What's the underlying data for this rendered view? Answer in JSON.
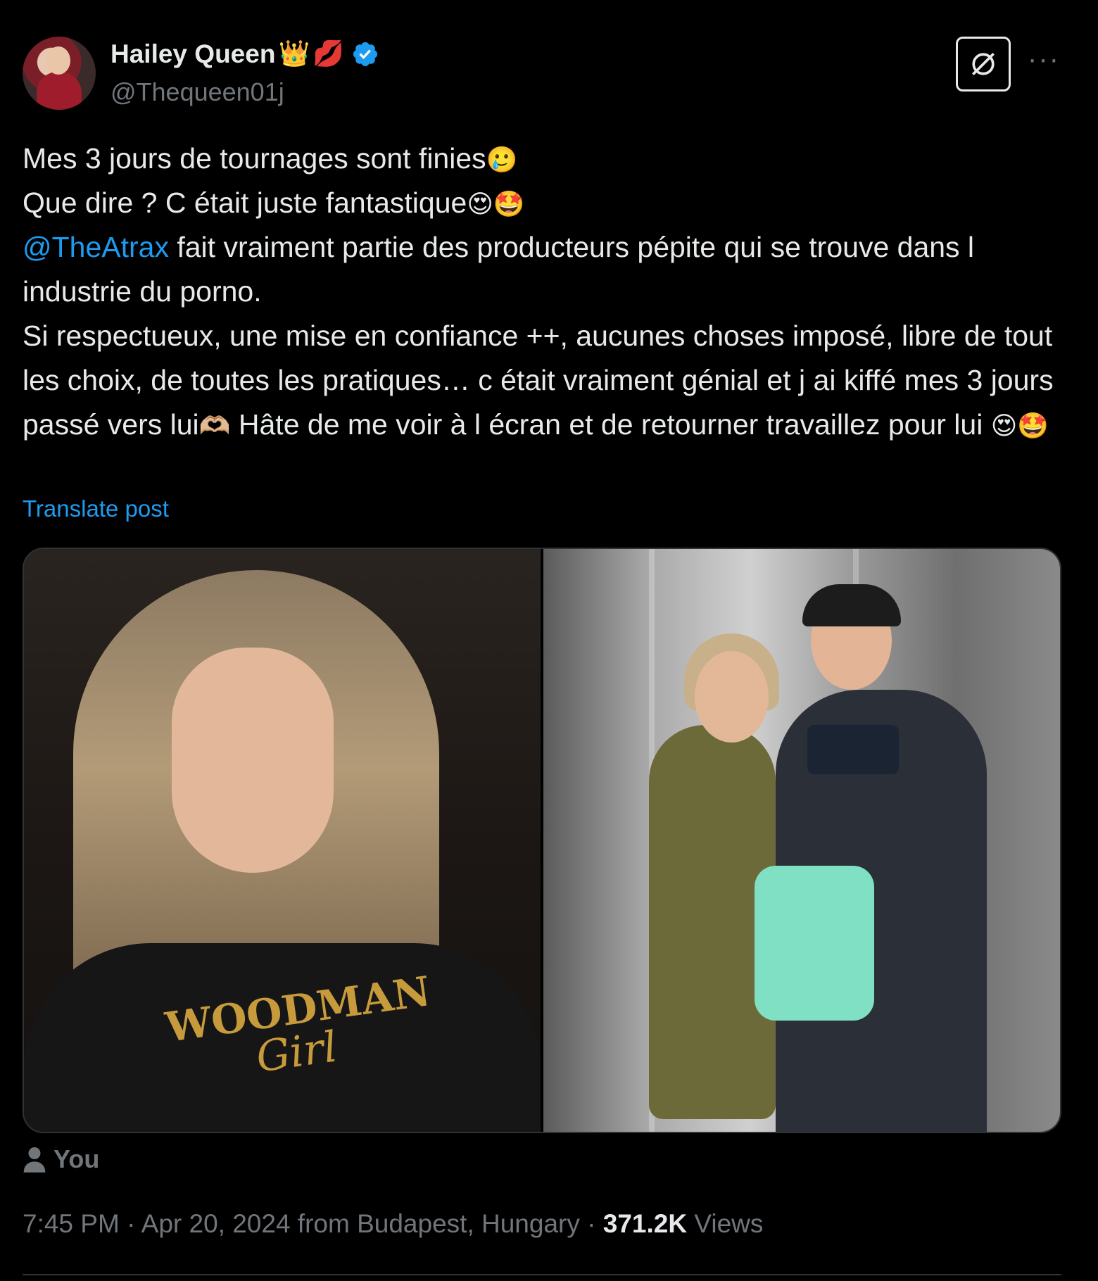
{
  "author": {
    "name": "Hailey Queen",
    "name_emojis": [
      "👑",
      "💋"
    ],
    "handle": "@Thequeen01j",
    "verified": true
  },
  "actions": {
    "grok_icon": "grok-icon",
    "more_label": "···"
  },
  "post": {
    "lines": [
      {
        "text": "Mes 3 jours de tournages sont finies",
        "emoji": "🥲"
      },
      {
        "text": "Que dire ? C était juste fantastique",
        "emoji": "😍🤩"
      },
      {
        "mention": "@TheAtrax",
        "text": " fait vraiment partie des producteurs pépite qui se trouve dans l industrie du porno."
      },
      {
        "text": "Si respectueux, une mise en confiance ++, aucunes choses imposé, libre de tout les choix, de toutes les pratiques… c était vraiment génial et j ai kiffé mes 3 jours passé vers lui",
        "emoji": "🫶🏼",
        "text2": " Hâte de me voir à l écran et de retourner travaillez pour lui ",
        "emoji2": "😍🤩"
      }
    ],
    "translate_label": "Translate post"
  },
  "media": {
    "left_shirt_text": "WOODMAN",
    "left_shirt_sub": "Girl"
  },
  "media_tag": {
    "label": "You"
  },
  "meta": {
    "time": "7:45 PM",
    "separator": " · ",
    "date": "Apr 20, 2024",
    "location": " from Budapest, Hungary",
    "views_count": "371.2K",
    "views_label": " Views"
  },
  "colors": {
    "background": "#000000",
    "text": "#e7e9ea",
    "secondary": "#71767b",
    "accent": "#1d9bf0",
    "border": "#2f3336"
  }
}
